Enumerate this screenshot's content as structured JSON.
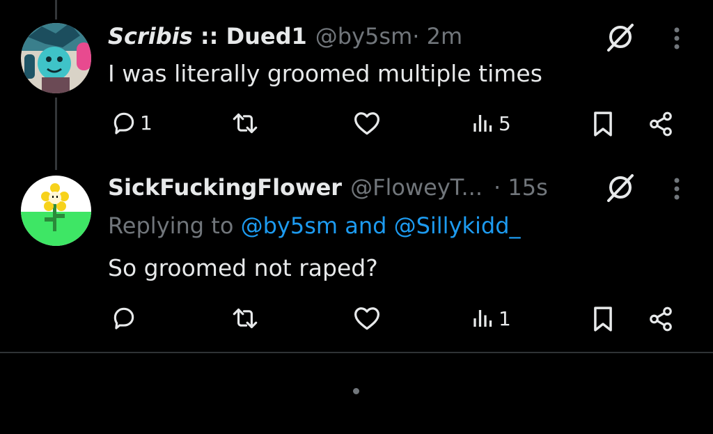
{
  "tweets": [
    {
      "name_prefix": "Scribis",
      "name_suffix": " :: Dued1",
      "handle": "@by5sm",
      "time": " · 2m",
      "text": "I was literally groomed multiple times",
      "replies": "1",
      "views": "5"
    },
    {
      "name": "SickFuckingFlower",
      "handle": "@FloweyT...",
      "time": " · 15s",
      "reply_prefix": "Replying to ",
      "reply_mention": "@by5sm and @Sillykidd_",
      "text": "So groomed not raped?",
      "replies": "",
      "views": "1"
    }
  ],
  "icons": {
    "grok": "grok-slash-icon",
    "more": "more-icon",
    "reply": "reply-icon",
    "retweet": "retweet-icon",
    "like": "like-icon",
    "views": "views-icon",
    "bookmark": "bookmark-icon",
    "share": "share-icon"
  },
  "colors": {
    "background": "#000000",
    "text": "#e7e9ea",
    "muted": "#71767b",
    "link": "#1d9bf0"
  }
}
